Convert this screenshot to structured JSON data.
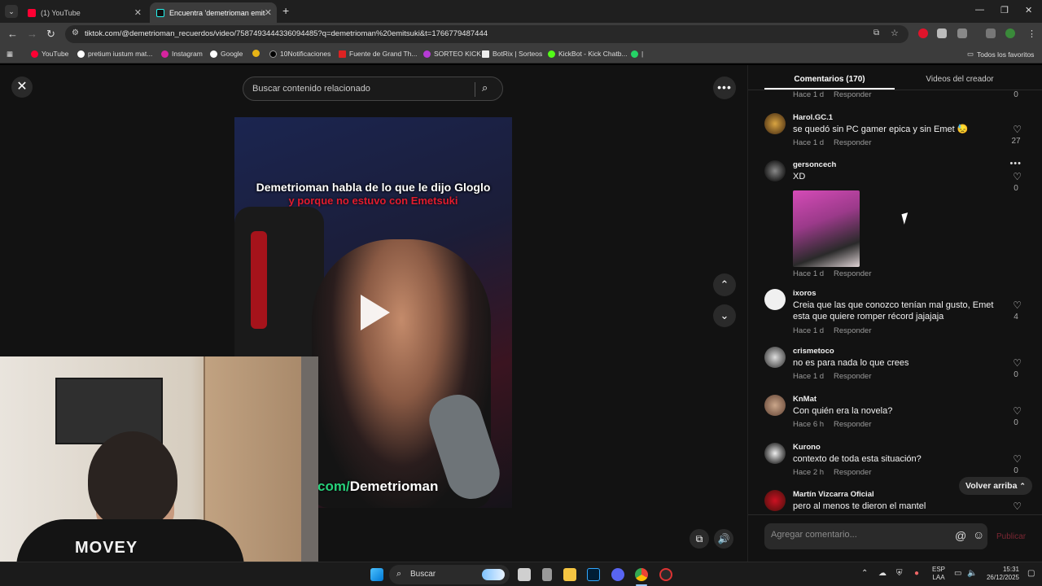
{
  "browser": {
    "tabs": [
      {
        "title": "(1) YouTube",
        "active": false
      },
      {
        "title": "Encuentra 'demetrioman emits",
        "active": true
      }
    ],
    "url": "tiktok.com/@demetrioman_recuerdos/video/7587493444336094485?q=demetrioman%20emitsuki&t=1766779487444",
    "bookmarks": [
      "YouTube",
      "pretium iustum mat...",
      "Instagram",
      "Google",
      "10Notificaciones",
      "Fuente de Grand Th...",
      "SORTEO KICK",
      "BotRix | Sorteos",
      "KickBot - Kick Chatb..."
    ],
    "all_bookmarks": "Todos los favoritos"
  },
  "page": {
    "search_placeholder": "Buscar contenido relacionado",
    "video": {
      "title_line1": "Demetrioman habla de lo que le dijo Gloglo",
      "title_line2": "y porque no estuvo con Emetsuki",
      "handle_prefix": "com/",
      "handle_name": "Demetrioman"
    },
    "webcam_shirt_text": "MOVEY"
  },
  "panel": {
    "tab_comments": "Comentarios (170)",
    "tab_creator": "Videos del creador",
    "reply_label": "Responder",
    "top_partial": {
      "time": "Hace 1 d",
      "likes": "0"
    },
    "comments": [
      {
        "user": "Harol.GC.1",
        "text": "se quedó sin PC gamer epica y sin Emet 😓",
        "time": "Hace 1 d",
        "likes": "27"
      },
      {
        "user": "gersoncech",
        "text": "XD",
        "time": "Hace 1 d",
        "likes": "0"
      },
      {
        "user": "ixoros",
        "text": "Creia que las que conozco tenían mal gusto, Emet esta que quiere romper récord jajajaja",
        "time": "Hace 1 d",
        "likes": "4"
      },
      {
        "user": "crismetoco",
        "text": "no es para nada lo que crees",
        "time": "Hace 1 d",
        "likes": "0"
      },
      {
        "user": "KnMat",
        "text": "Con quién era la novela?",
        "time": "Hace 6 h",
        "likes": "0"
      },
      {
        "user": "Kurono",
        "text": "contexto de toda esta situación?",
        "time": "Hace 2 h",
        "likes": "0"
      },
      {
        "user": "Martín Vizcarra Oficial",
        "text": "pero al menos te dieron el mantel",
        "time": "",
        "likes": ""
      }
    ],
    "back_to_top": "Volver arriba",
    "composer_placeholder": "Agregar comentario...",
    "publish": "Publicar"
  },
  "taskbar": {
    "search": "Buscar",
    "lang1": "ESP",
    "lang2": "LAA",
    "time": "15:31",
    "date": "26/12/2025"
  },
  "colors": {
    "accent_red": "#fe2c55",
    "publish_disabled": "#7b2733",
    "handle_green": "#27d07a"
  }
}
